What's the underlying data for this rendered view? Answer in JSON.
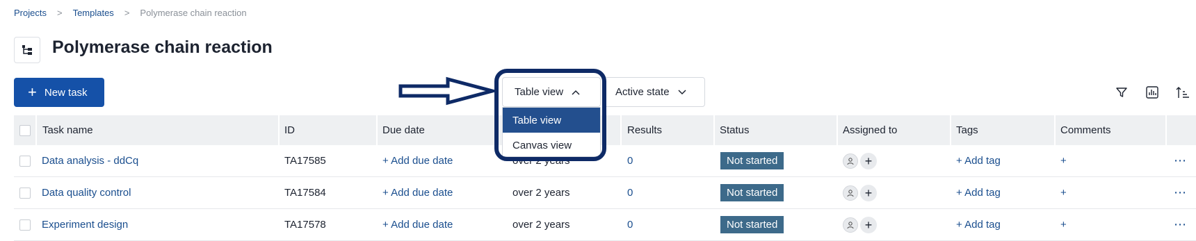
{
  "breadcrumb": {
    "items": [
      "Projects",
      "Templates"
    ],
    "current": "Polymerase chain reaction"
  },
  "page": {
    "title": "Polymerase chain reaction",
    "icon": "hierarchy-icon"
  },
  "toolbar": {
    "new_task_label": "New task",
    "view_selected": "Table view",
    "state_selected": "Active state",
    "view_menu": [
      "Table view",
      "Canvas view"
    ]
  },
  "table": {
    "headers": [
      "Task name",
      "ID",
      "Due date",
      "",
      "Results",
      "Status",
      "Assigned to",
      "Tags",
      "Comments"
    ],
    "rows": [
      {
        "name": "Data analysis - ddCq",
        "id": "TA17585",
        "due": "+ Add due date",
        "age": "over 2 years",
        "results": "0",
        "status": "Not started",
        "tags": "+ Add tag",
        "comments": "+",
        "more": "⋯"
      },
      {
        "name": "Data quality control",
        "id": "TA17584",
        "due": "+ Add due date",
        "age": "over 2 years",
        "results": "0",
        "status": "Not started",
        "tags": "+ Add tag",
        "comments": "+",
        "more": "⋯"
      },
      {
        "name": "Experiment design",
        "id": "TA17578",
        "due": "+ Add due date",
        "age": "over 2 years",
        "results": "0",
        "status": "Not started",
        "tags": "+ Add tag",
        "comments": "+",
        "more": "⋯"
      }
    ]
  },
  "colors": {
    "primary": "#1551a8",
    "link": "#1a4e8e",
    "status_badge": "#3d6a8a",
    "highlight": "#0e2a66",
    "menu_selected": "#234f8e"
  }
}
